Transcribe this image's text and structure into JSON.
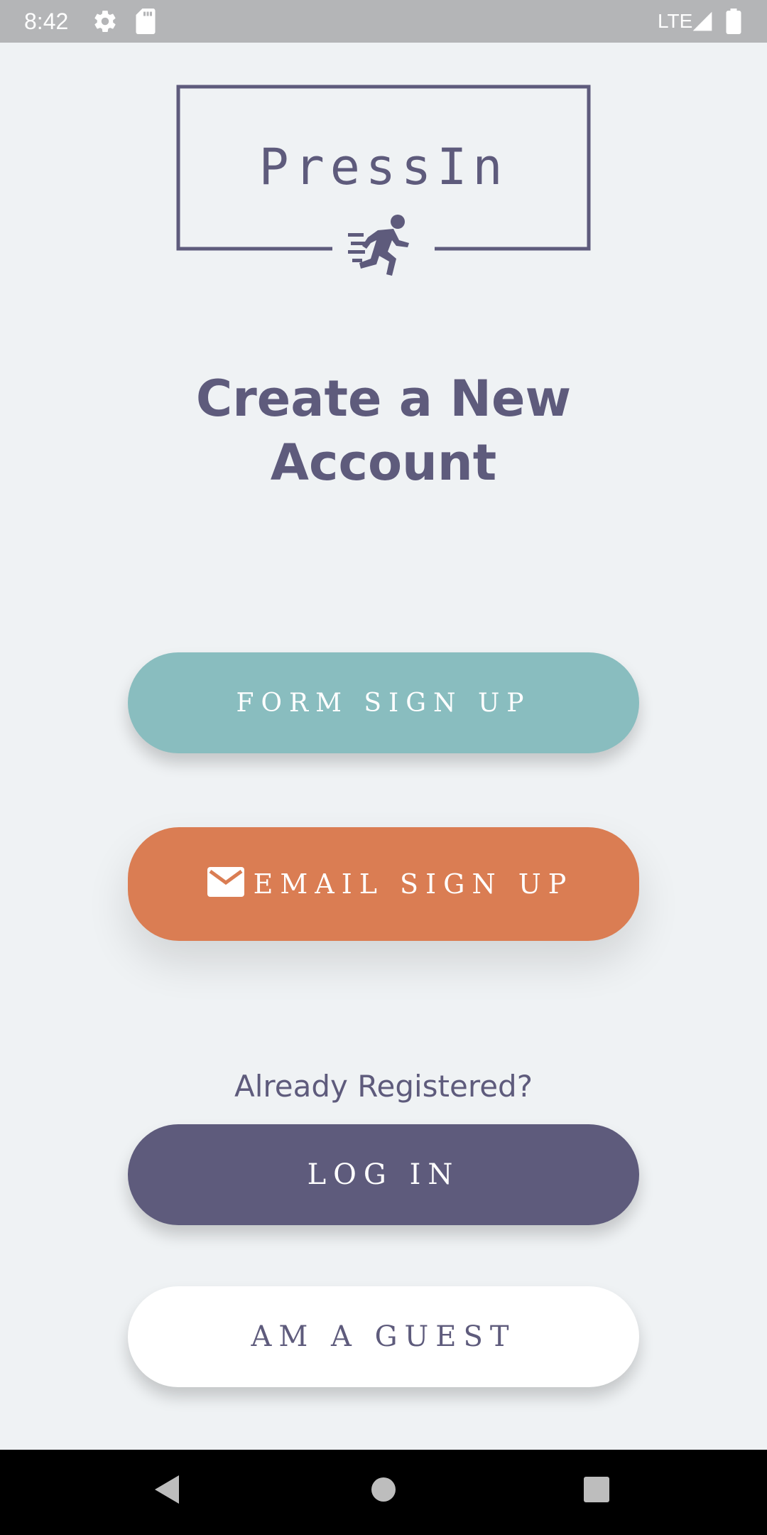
{
  "status_bar": {
    "time": "8:42",
    "network": "LTE",
    "icons": [
      "settings-gear-icon",
      "sd-card-icon",
      "signal-icon",
      "battery-icon"
    ]
  },
  "logo": {
    "text": "PressIn",
    "icon": "running-person-icon",
    "color": "#5e5b7c"
  },
  "heading": {
    "line1": "Create a New",
    "line2": "Account"
  },
  "buttons": {
    "form_signup": "Form Sign up",
    "email_signup": "Email Sign up",
    "already_registered": "Already Registered?",
    "login": "Log In",
    "guest": "Am a Guest"
  },
  "colors": {
    "background": "#eff2f4",
    "teal": "#89bdbf",
    "orange": "#da7d53",
    "purple": "#5e5b7c",
    "white": "#ffffff"
  },
  "nav_bar": {
    "icons": [
      "back-icon",
      "home-icon",
      "recents-icon"
    ]
  }
}
